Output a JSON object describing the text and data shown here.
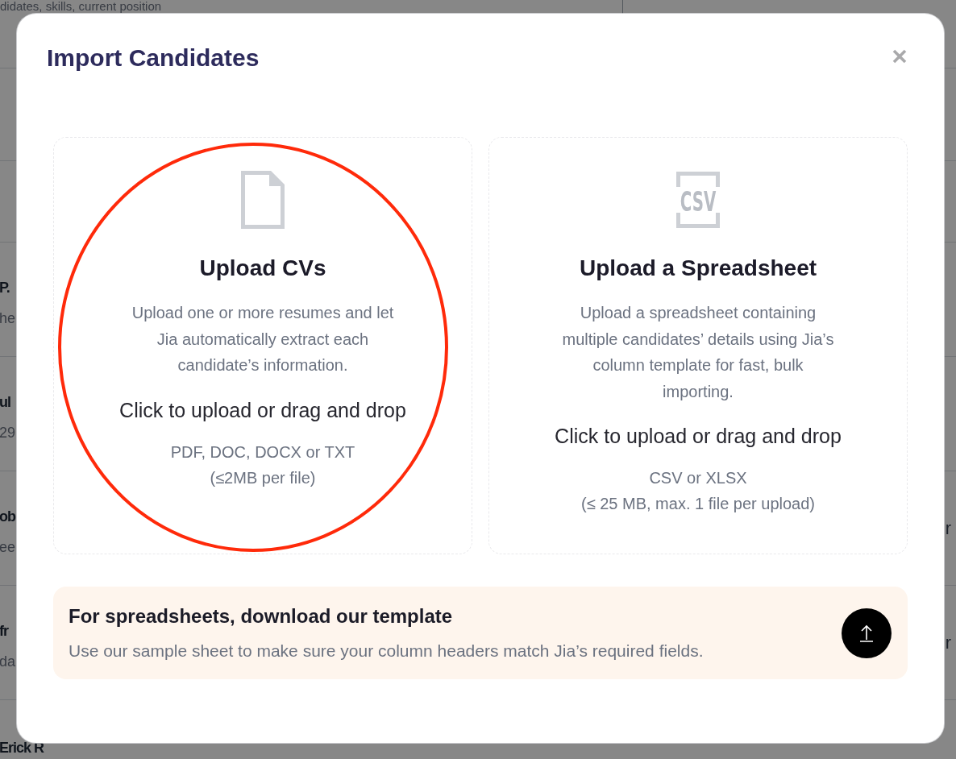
{
  "background_page": {
    "top_text": "didates, skills, current position",
    "rows": [
      {
        "name": "P.",
        "detail": "he"
      },
      {
        "name": "ul",
        "detail": "29"
      },
      {
        "name": "ob",
        "detail": "ee",
        "column_3": "r"
      },
      {
        "name": "fr",
        "detail": "da",
        "column_3": "r"
      },
      {
        "name": "Erick R"
      }
    ]
  },
  "dialog": {
    "title": "Import Candidates",
    "options": [
      {
        "kind": "cv",
        "title": "Upload CVs",
        "description": "Upload one or more resumes and let Jia automatically extract each candidate’s information.",
        "action": "Click to upload or drag and drop",
        "formats": "PDF, DOC, DOCX or TXT",
        "limit": "(≤2MB per file)",
        "highlighted": true
      },
      {
        "kind": "csv",
        "icon_text": "CSV",
        "title": "Upload a Spreadsheet",
        "description": "Upload a spreadsheet containing multiple candidates’ details using Jia’s column template for fast, bulk importing.",
        "action": "Click to upload or drag and drop",
        "formats": "CSV or XLSX",
        "limit": "(≤ 25 MB, max. 1 file per upload)",
        "highlighted": false
      }
    ],
    "template_banner": {
      "title": "For spreadsheets, download our template",
      "description": "Use our sample sheet to make sure your column headers match Jia’s required fields."
    }
  }
}
